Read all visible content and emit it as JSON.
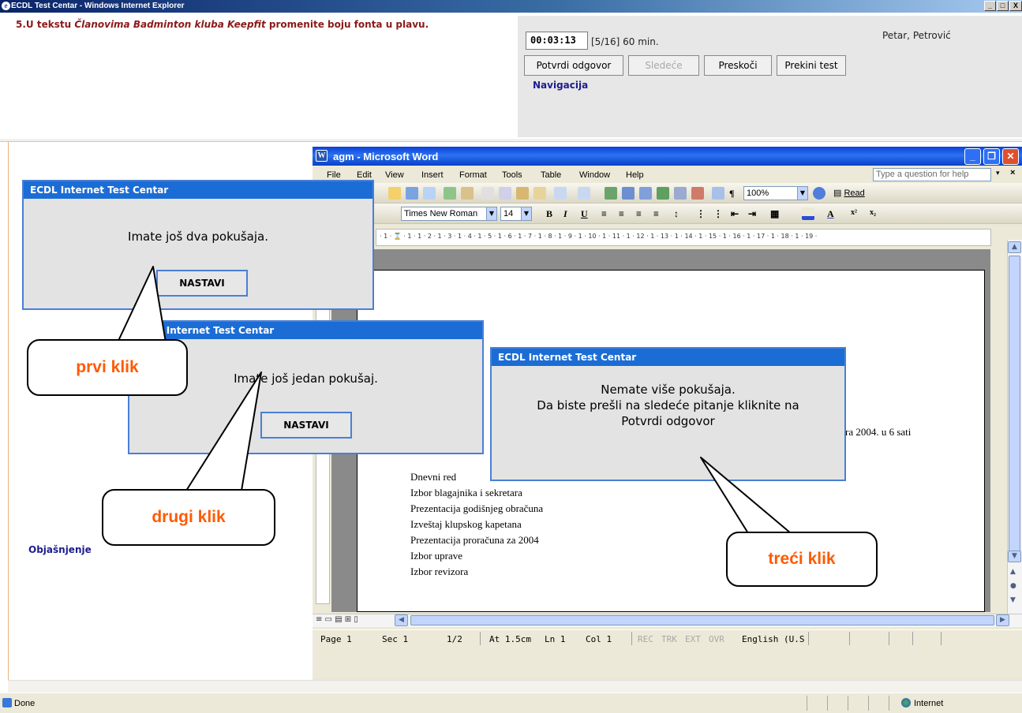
{
  "ie_window": {
    "title": "ECDL Test Centar - Windows Internet Explorer",
    "controls": {
      "minimize": "_",
      "maximize": "□",
      "close": "X"
    }
  },
  "question": {
    "number": "5.",
    "prefix": "U tekstu ",
    "italic": "Članovima Badminton kluba Keepfit",
    "suffix": " promenite boju fonta u plavu."
  },
  "test_controls": {
    "timer": "00:03:13",
    "question_count": "[5/16] 60 min.",
    "user_name": "Petar, Petrović",
    "buttons": {
      "confirm": "Potvrdi odgovor",
      "next": "Sledeće",
      "skip": "Preskoči",
      "stop": "Prekini test"
    },
    "navigation_link": "Navigacija"
  },
  "left_panel": {
    "explanation_link": "Objašnjenje"
  },
  "word": {
    "title": "agm - Microsoft Word",
    "menu": [
      "File",
      "Edit",
      "View",
      "Insert",
      "Format",
      "Tools",
      "Table",
      "Window",
      "Help"
    ],
    "help_box_placeholder": "Type a question for help",
    "toolbar": {
      "zoom": "100%",
      "read_button": "Read",
      "font_name": "Times New Roman",
      "font_size": "14"
    },
    "ruler_text": "· 1 · ⌛ · 1 · 1 · 2 · 1 · 3 · 1 · 4 · 1 · 5 · 1 · 6 · 1 · 7 · 1 · 8 · 1 · 9 · 1 · 10 · 1 · 11 · 1 · 12 · 1 · 13 · 1 · 14 · 1 · 15 · 1 · 16 · 1 · 17 · 1 · 18 · 1 · 19 ·",
    "document": {
      "fragment_right": "ra 2004. u 6 sati",
      "agenda": [
        "Dnevni red",
        "Izbor blagajnika i sekretara",
        "Prezentacija godišnjeg obračuna",
        "Izveštaj klupskog kapetana",
        "Prezentacija proračuna za 2004",
        "Izbor uprave",
        "Izbor revizora"
      ]
    },
    "status": {
      "page": "Page 1",
      "section": "Sec 1",
      "pages": "1/2",
      "at": "At 1.5cm",
      "line": "Ln 1",
      "col": "Col 1",
      "rec": "REC",
      "trk": "TRK",
      "ext": "EXT",
      "ovr": "OVR",
      "language": "English (U.S"
    }
  },
  "dialogs": [
    {
      "title": "ECDL Internet Test Centar",
      "message": "Imate još dva pokušaja.",
      "button": "NASTAVI"
    },
    {
      "title": "ECDL Internet Test Centar",
      "message": "Imate još jedan pokušaj.",
      "button": "NASTAVI"
    },
    {
      "title": "ECDL Internet Test Centar",
      "message_lines": [
        "Nemate više pokušaja.",
        "Da biste prešli na sledeće pitanje kliknite na",
        "Potvrdi odgovor"
      ]
    }
  ],
  "callouts": {
    "first": "prvi klik",
    "second": "drugi klik",
    "third": "treći klik"
  },
  "browser_status": {
    "left": "Done",
    "zone": "Internet"
  },
  "colors": {
    "dialog_header": "#1b6dd5",
    "callout_text": "#ff5a00",
    "question_text": "#8b1a1a",
    "link": "#1c1c8f"
  }
}
